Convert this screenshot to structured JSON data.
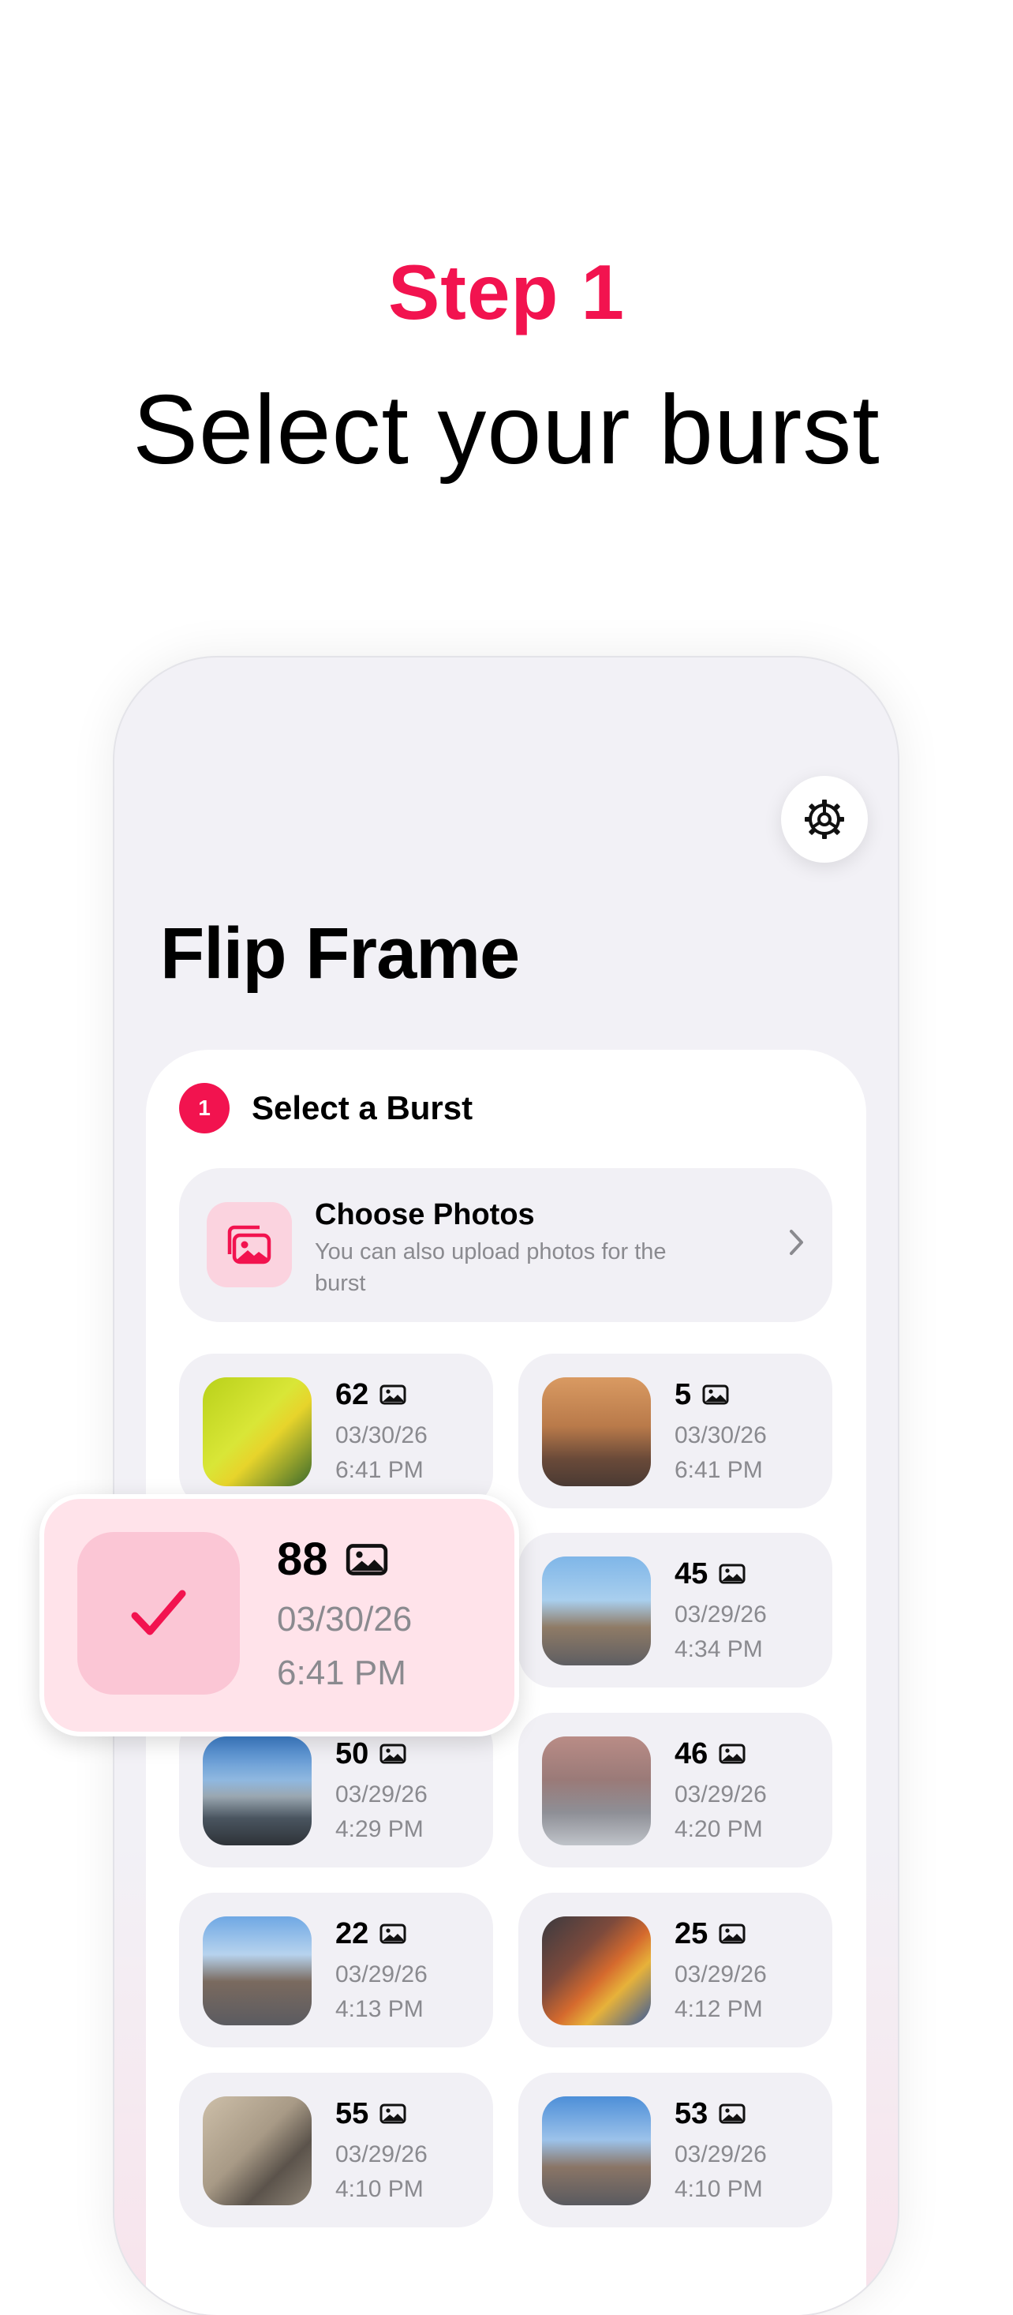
{
  "header": {
    "step": "Step 1",
    "headline": "Select your burst"
  },
  "app": {
    "title": "Flip Frame",
    "settings_icon": "gear-icon"
  },
  "section": {
    "number": "1",
    "title": "Select a Burst"
  },
  "choose": {
    "title": "Choose Photos",
    "subtitle": "You can also upload photos for the burst",
    "icon": "photos-icon"
  },
  "bursts": [
    {
      "count": "62",
      "date": "03/30/26",
      "time": "6:41 PM"
    },
    {
      "count": "5",
      "date": "03/30/26",
      "time": "6:41 PM"
    },
    {
      "count": "45",
      "date": "03/29/26",
      "time": "4:34 PM"
    },
    {
      "count": "50",
      "date": "03/29/26",
      "time": "4:29 PM"
    },
    {
      "count": "46",
      "date": "03/29/26",
      "time": "4:20 PM"
    },
    {
      "count": "22",
      "date": "03/29/26",
      "time": "4:13 PM"
    },
    {
      "count": "25",
      "date": "03/29/26",
      "time": "4:12 PM"
    },
    {
      "count": "55",
      "date": "03/29/26",
      "time": "4:10 PM"
    },
    {
      "count": "53",
      "date": "03/29/26",
      "time": "4:10 PM"
    }
  ],
  "selected": {
    "count": "88",
    "date": "03/30/26",
    "time": "6:41 PM"
  },
  "colors": {
    "accent": "#f2134f",
    "tile_bg": "#f1f0f5",
    "selected_bg": "#ffe3ea"
  }
}
